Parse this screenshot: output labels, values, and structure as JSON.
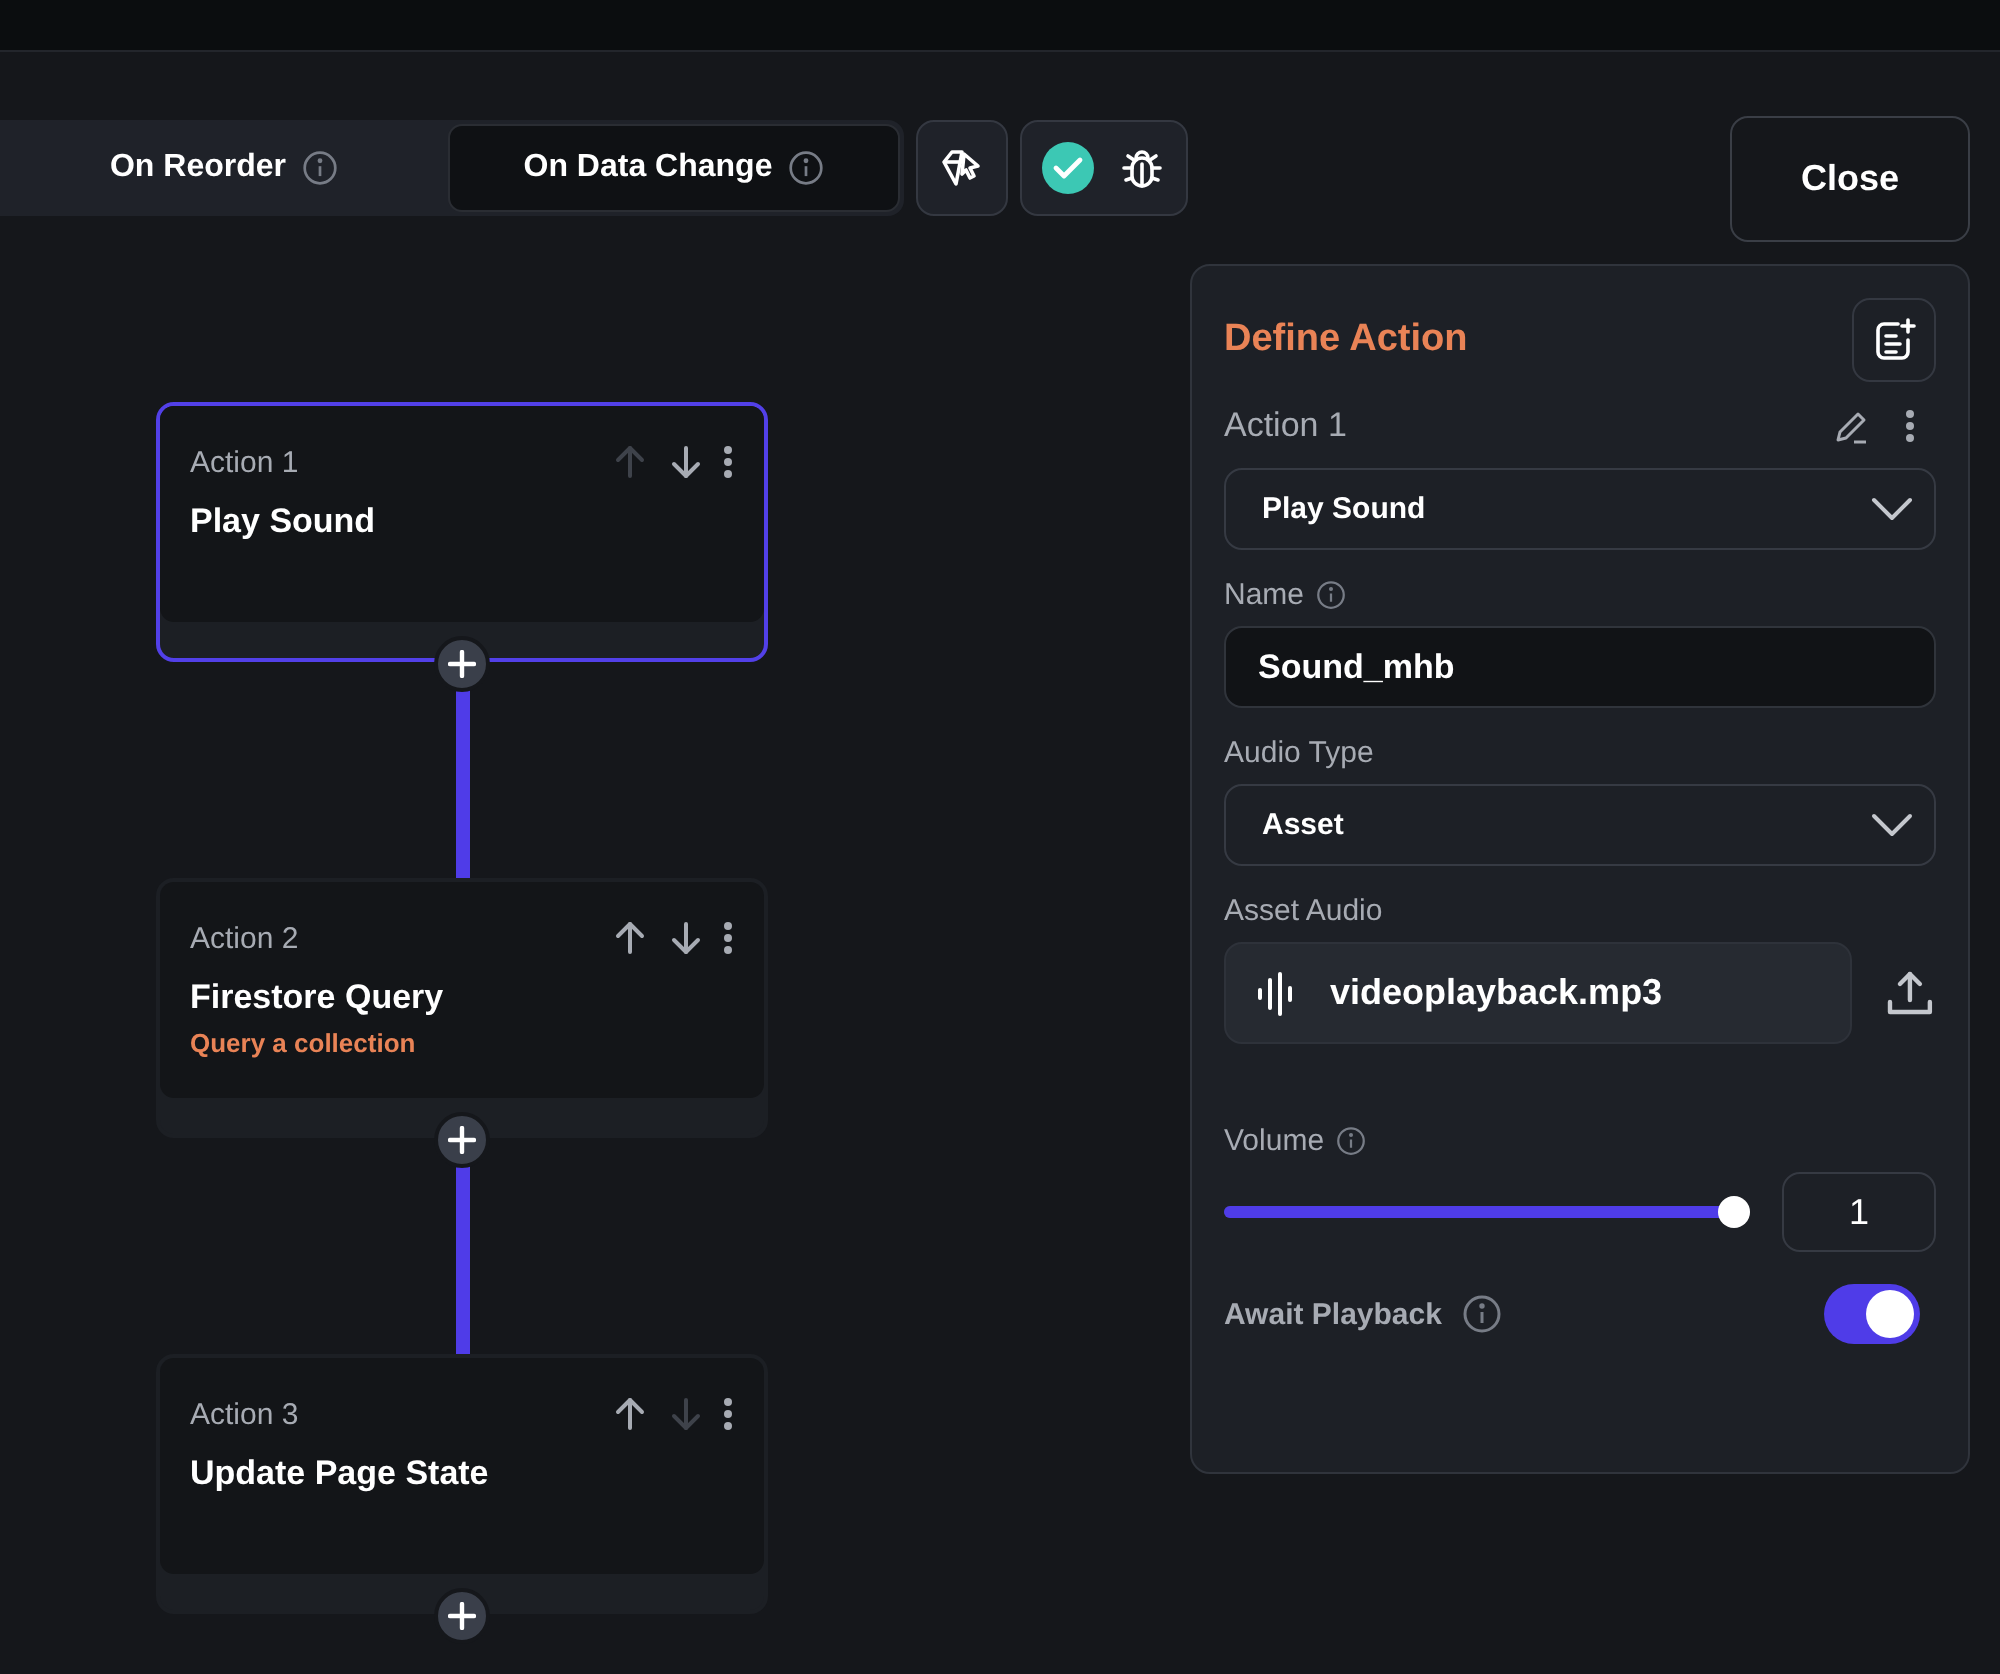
{
  "tabs": [
    {
      "label": "On Reorder",
      "selected": false
    },
    {
      "label": "On Data Change",
      "selected": true
    }
  ],
  "close_button": "Close",
  "actions": [
    {
      "label": "Action 1",
      "title": "Play Sound",
      "selected": true,
      "up_disabled": true,
      "down_disabled": false
    },
    {
      "label": "Action 2",
      "title": "Firestore Query",
      "subtitle": "Query a collection",
      "selected": false,
      "up_disabled": false,
      "down_disabled": false
    },
    {
      "label": "Action 3",
      "title": "Update Page State",
      "selected": false,
      "up_disabled": false,
      "down_disabled": true
    }
  ],
  "panel": {
    "title": "Define Action",
    "action_label": "Action 1",
    "action_type": "Play Sound",
    "name_label": "Name",
    "name_value": "Sound_mhb",
    "audio_type_label": "Audio Type",
    "audio_type": "Asset",
    "asset_audio_label": "Asset Audio",
    "asset_file": "videoplayback.mp3",
    "volume_label": "Volume",
    "volume": {
      "level": 1,
      "reading": "1"
    },
    "await_label": "Await Playback",
    "await_on": true
  }
}
